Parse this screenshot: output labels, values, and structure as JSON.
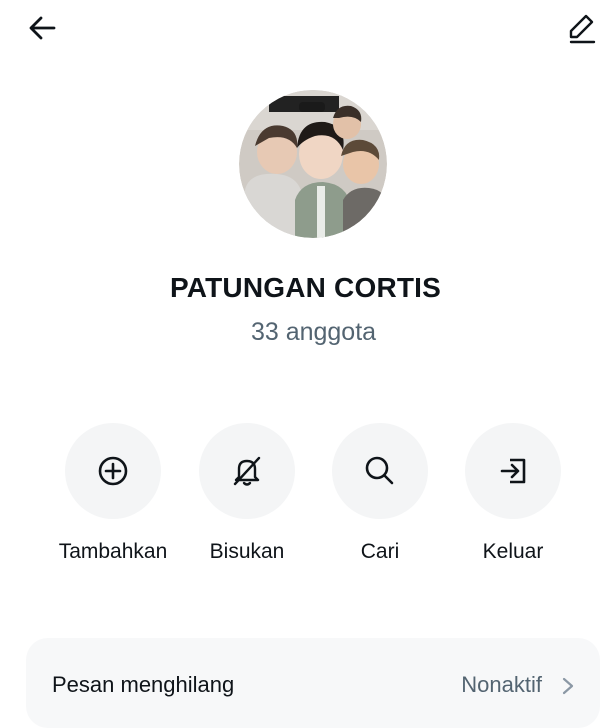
{
  "header": {
    "back_icon": "arrow-left-icon",
    "edit_icon": "pencil-edit-icon"
  },
  "group": {
    "name": "PATUNGAN CORTIS",
    "member_count": "33 anggota",
    "avatar_icon": "group-photo-avatar"
  },
  "actions": [
    {
      "label": "Tambahkan",
      "icon": "add-circle-icon"
    },
    {
      "label": "Bisukan",
      "icon": "bell-muted-icon"
    },
    {
      "label": "Cari",
      "icon": "search-icon"
    },
    {
      "label": "Keluar",
      "icon": "exit-icon"
    }
  ],
  "settings": {
    "disappearing_messages": {
      "label": "Pesan menghilang",
      "value": "Nonaktif",
      "icon": "chevron-right-icon"
    }
  },
  "colors": {
    "text_primary": "#0f1419",
    "text_secondary": "#536471",
    "action_bg": "#f4f5f6",
    "card_bg": "#f7f8f9"
  }
}
